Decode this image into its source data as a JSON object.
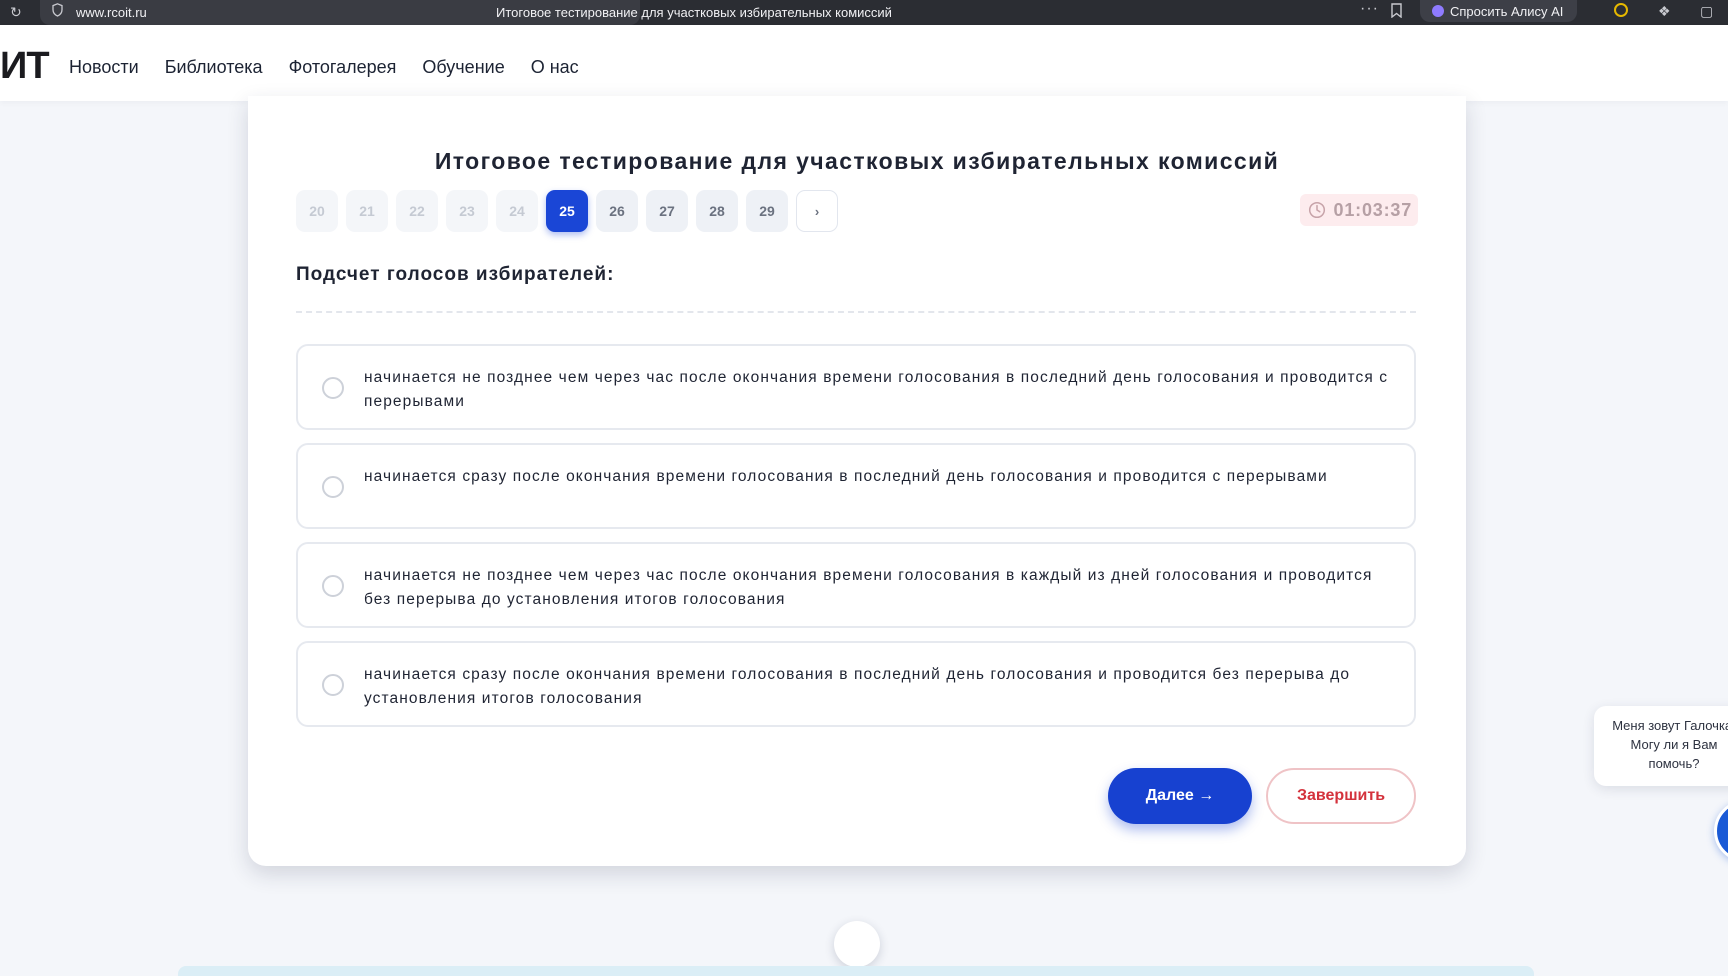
{
  "browser": {
    "url": "www.rcoit.ru",
    "tab_title": "Итоговое тестирование для участковых избирательных комиссий",
    "menu_dots": "···",
    "alice_label": "Спросить Алису AI"
  },
  "header": {
    "logo": "ИТ",
    "nav": [
      "Новости",
      "Библиотека",
      "Фотогалерея",
      "Обучение",
      "О нас"
    ]
  },
  "test": {
    "title": "Итоговое тестирование для участковых избирательных комиссий",
    "question_numbers": [
      "20",
      "21",
      "22",
      "23",
      "24",
      "25",
      "26",
      "27",
      "28",
      "29"
    ],
    "current_question": "25",
    "next_page_symbol": "›",
    "timer": "01:03:37",
    "question": "Подсчет голосов избирателей:",
    "answers": [
      "начинается не позднее чем через час после окончания времени голосования в последний день голосования и проводится с перерывами",
      "начинается сразу после окончания времени голосования в последний день голосования и проводится с перерывами",
      "начинается не позднее чем через час после окончания времени голосования в каждый из дней голосования и проводится без перерыва до установления итогов голосования",
      "начинается сразу после окончания времени голосования в последний день голосования и проводится без перерыва до установления итогов голосования"
    ],
    "next_label": "Далее →",
    "finish_label": "Завершить"
  },
  "chat": {
    "lines": [
      "Меня зовут Галочка!",
      "Могу ли я Вам",
      "помочь?"
    ]
  },
  "colors": {
    "accent": "#1a46d6",
    "finish": "#d4323c",
    "timer_bg": "#fdecee"
  }
}
